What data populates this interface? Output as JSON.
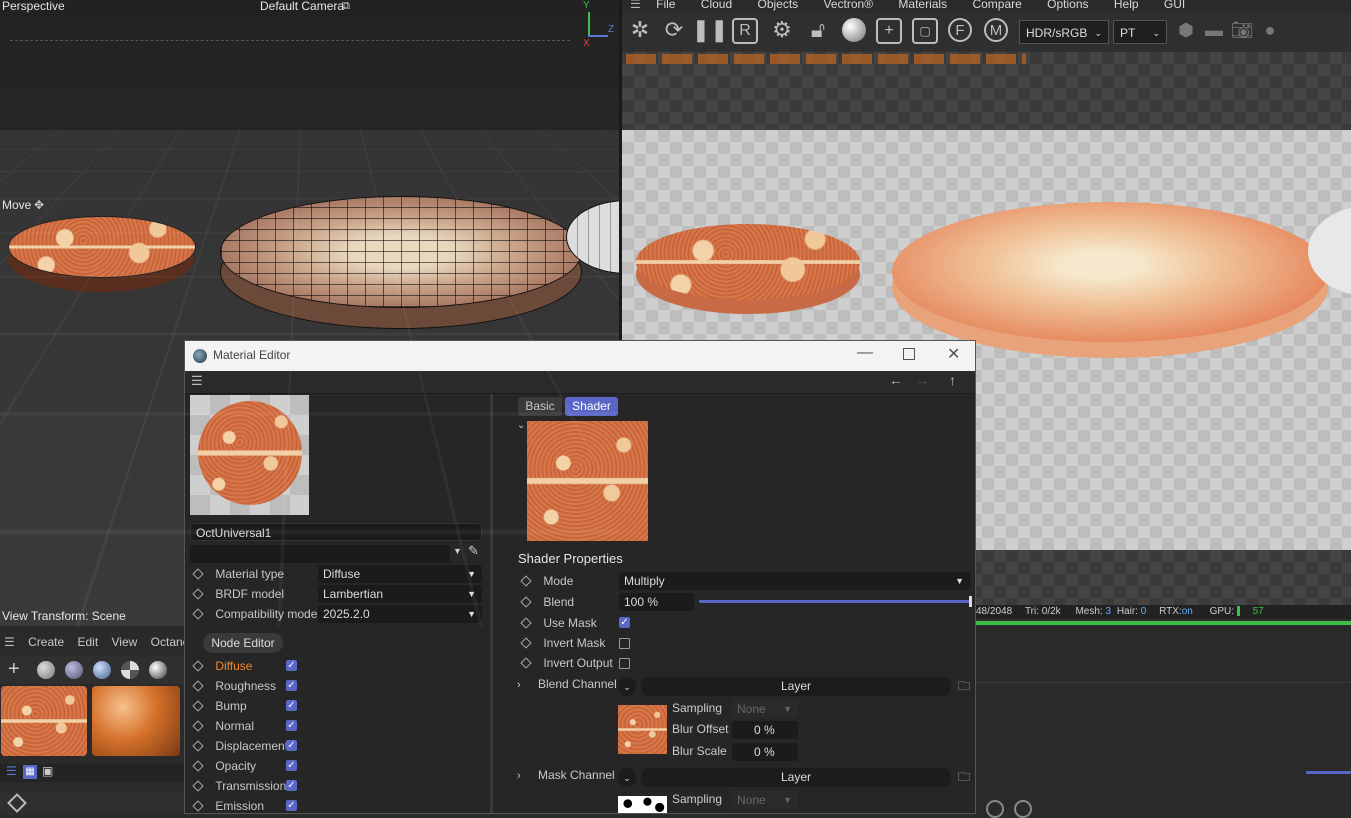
{
  "viewport": {
    "perspective_label": "Perspective",
    "camera_label": "Default Camera",
    "move_label": "Move",
    "view_transform": "View Transform: Scene",
    "axis_x": "X",
    "axis_y": "Y",
    "axis_z": "Z"
  },
  "octane": {
    "menu": [
      "File",
      "Cloud",
      "Objects",
      "Vectron®",
      "Materials",
      "Compare",
      "Options",
      "Help",
      "GUI"
    ],
    "color_space": "HDR/sRGB",
    "kernel": "PT",
    "status": {
      "res": "48/2048",
      "tri": "Tri: 0/2k",
      "mesh_label": "Mesh:",
      "mesh_value": "3",
      "hair_label": "Hair:",
      "hair_value": "0",
      "rtx_label": "RTX:",
      "rtx_value": "on",
      "gpu_label": "GPU:",
      "gpu_value": "57"
    }
  },
  "bottom_left": {
    "menu": [
      "Create",
      "Edit",
      "View",
      "Octane"
    ]
  },
  "material_editor": {
    "title": "Material Editor",
    "material_name": "OctUniversal1",
    "properties": [
      {
        "label": "Material type",
        "value": "Diffuse"
      },
      {
        "label": "BRDF model",
        "value": "Lambertian"
      },
      {
        "label": "Compatibility mode",
        "value": "2025.2.0"
      }
    ],
    "node_editor_label": "Node Editor",
    "channels": [
      {
        "label": "Diffuse",
        "active": true
      },
      {
        "label": "Roughness"
      },
      {
        "label": "Bump"
      },
      {
        "label": "Normal"
      },
      {
        "label": "Displacement"
      },
      {
        "label": "Opacity"
      },
      {
        "label": "Transmission"
      },
      {
        "label": "Emission"
      }
    ],
    "tabs": {
      "basic": "Basic",
      "shader": "Shader"
    },
    "shader_properties_title": "Shader Properties",
    "mode_label": "Mode",
    "mode_value": "Multiply",
    "blend_label": "Blend",
    "blend_value": "100 %",
    "blend_fraction": 1.0,
    "use_mask_label": "Use Mask",
    "invert_mask_label": "Invert Mask",
    "invert_output_label": "Invert Output",
    "blend_channel_label": "Blend Channel",
    "mask_channel_label": "Mask Channel",
    "layer_label": "Layer",
    "sampling_label": "Sampling",
    "sampling_value": "None",
    "blur_offset_label": "Blur Offset",
    "blur_offset_value": "0 %",
    "blur_scale_label": "Blur Scale",
    "blur_scale_value": "0 %"
  },
  "colors": {
    "accent": "#5a67c7",
    "active_channel": "#f08a2c",
    "gpu_bar": "#3fbf4a"
  }
}
